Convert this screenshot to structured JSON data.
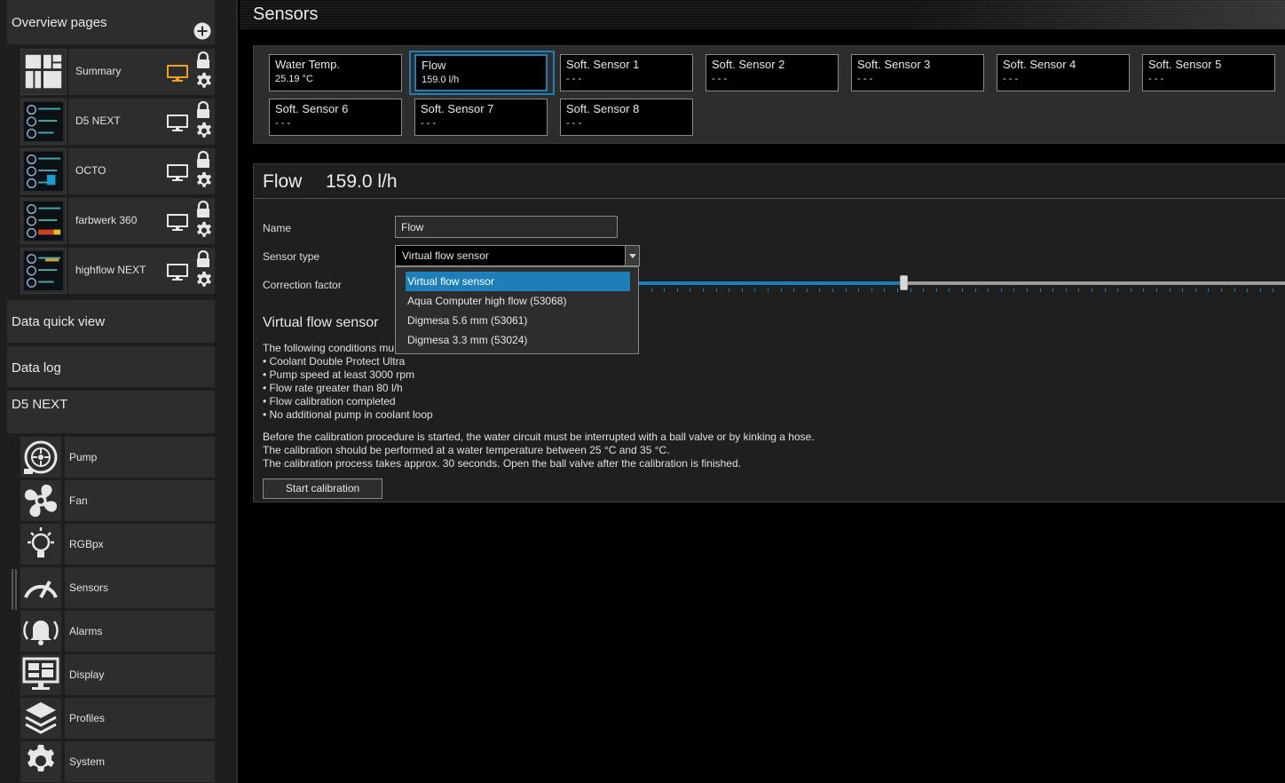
{
  "sidebar": {
    "overview_title": "Overview pages",
    "overview_pages": [
      {
        "label": "Summary",
        "monitor_color": "#f0a020"
      },
      {
        "label": "D5 NEXT",
        "monitor_color": "#e6e6e6"
      },
      {
        "label": "OCTO",
        "monitor_color": "#e6e6e6"
      },
      {
        "label": "farbwerk 360",
        "monitor_color": "#e6e6e6"
      },
      {
        "label": "highflow NEXT",
        "monitor_color": "#e6e6e6"
      }
    ],
    "data_quick_view": "Data quick view",
    "data_log": "Data log",
    "device_title": "D5 NEXT",
    "device_items": [
      {
        "label": "Pump",
        "icon": "pump-icon"
      },
      {
        "label": "Fan",
        "icon": "fan-icon"
      },
      {
        "label": "RGBpx",
        "icon": "bulb-icon"
      },
      {
        "label": "Sensors",
        "icon": "gauge-icon"
      },
      {
        "label": "Alarms",
        "icon": "bell-icon"
      },
      {
        "label": "Display",
        "icon": "display-icon"
      },
      {
        "label": "Profiles",
        "icon": "layers-icon"
      },
      {
        "label": "System",
        "icon": "gear-icon"
      }
    ]
  },
  "header": {
    "title": "Sensors"
  },
  "tiles": [
    {
      "name": "Water Temp.",
      "value": "25.19 °C"
    },
    {
      "name": "Flow",
      "value": "159.0 l/h"
    },
    {
      "name": "Soft. Sensor 1",
      "value": "- - -"
    },
    {
      "name": "Soft. Sensor 2",
      "value": "- - -"
    },
    {
      "name": "Soft. Sensor 3",
      "value": "- - -"
    },
    {
      "name": "Soft. Sensor 4",
      "value": "- - -"
    },
    {
      "name": "Soft. Sensor 5",
      "value": "- - -"
    },
    {
      "name": "Soft. Sensor 6",
      "value": "- - -"
    },
    {
      "name": "Soft. Sensor 7",
      "value": "- - -"
    },
    {
      "name": "Soft. Sensor 8",
      "value": "- - -"
    }
  ],
  "detail": {
    "name": "Flow",
    "value": "159.0 l/h",
    "name_label": "Name",
    "name_value": "Flow",
    "sensor_type_label": "Sensor type",
    "sensor_type_value": "Virtual flow sensor",
    "correction_label": "Correction factor",
    "correction_fraction": 0.41,
    "section_title": "Virtual flow sensor",
    "conditions_intro": "The following conditions mu",
    "conditions": [
      "• Coolant Double Protect Ultra",
      "• Pump speed at least 3000 rpm",
      "• Flow rate greater than 80 l/h",
      "• Flow calibration completed",
      "• No additional pump in coolant loop"
    ],
    "notes": [
      "Before the calibration procedure is started, the water circuit must be interrupted with a ball valve or by kinking a hose.",
      "The calibration should be performed at a water temperature between 25 °C and 35 °C.",
      "The calibration process takes approx. 30 seconds. Open the ball valve after the calibration is finished."
    ],
    "calibrate_button": "Start calibration"
  },
  "dropdown_options": [
    "Virtual flow sensor",
    "Aqua Computer high flow (53068)",
    "Digmesa 5.6 mm (53061)",
    "Digmesa 3.3 mm (53024)"
  ],
  "colors": {
    "accent": "#1e7fb8",
    "active_monitor": "#f0a020"
  }
}
